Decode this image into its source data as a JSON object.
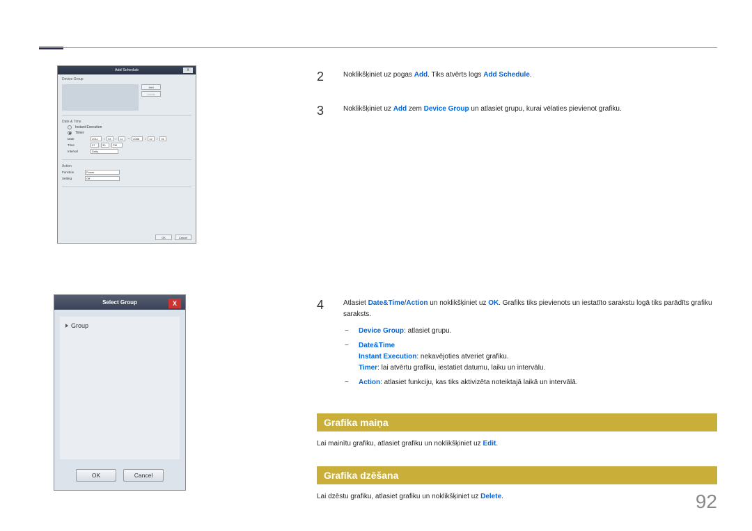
{
  "page_number": "92",
  "steps": {
    "s2": {
      "num": "2",
      "t1": "Noklikšķiniet uz pogas ",
      "b1": "Add",
      "t2": ". Tiks atvērts logs ",
      "b2": "Add Schedule",
      "t3": "."
    },
    "s3": {
      "num": "3",
      "t1": "Noklikšķiniet uz ",
      "b1": "Add",
      "t2": " zem ",
      "b2": "Device Group",
      "t3": " un atlasiet grupu, kurai vēlaties pievienot grafiku."
    },
    "s4": {
      "num": "4",
      "t1a": "Atlasiet ",
      "b1": "Date&Time",
      "slash": "/",
      "b2": "Action",
      "t1b": " un noklikšķiniet uz ",
      "b3": "OK",
      "t1c": ". Grafiks tiks pievienots un iestatīto sarakstu logā tiks parādīts grafiku saraksts.",
      "li1_b": "Device Group",
      "li1_t": ": atlasiet grupu.",
      "li2_b": "Date&Time",
      "li2_ib": "Instant Execution",
      "li2_it": ": nekavējoties atveriet grafiku.",
      "li2_tb": "Timer",
      "li2_tt": ": lai atvērtu grafiku, iestatiet datumu, laiku un intervālu.",
      "li3_b": "Action",
      "li3_t": ":  atlasiet funkciju, kas tiks aktivizēta noteiktajā laikā un intervālā."
    }
  },
  "sections": {
    "change": {
      "heading": "Grafika maiņa",
      "t1": "Lai mainītu grafiku, atlasiet grafiku un noklikšķiniet uz ",
      "b1": "Edit",
      "t2": "."
    },
    "delete": {
      "heading": "Grafika dzēšana",
      "t1": "Lai dzēstu grafiku, atlasiet grafiku un noklikšķiniet uz ",
      "b1": "Delete",
      "t2": "."
    }
  },
  "screenshot1": {
    "title": "Add Schedule",
    "close": "X",
    "device_group": "Device Group",
    "add": "Add",
    "delete": "Delete",
    "date_time": "Date & Time",
    "instant_exec": "Instant Execution",
    "timer": "Timer",
    "date": "Date",
    "date_val1": "2011",
    "date_val2": "04",
    "date_val3": "11",
    "tilde": "~",
    "date_val4": "2088",
    "date_val5": "12",
    "date_val6": "31",
    "time": "Time",
    "time_h": "07",
    "time_m": "30",
    "time_ampm": "PM",
    "interval": "Interval",
    "interval_val": "Daily",
    "action": "Action",
    "function": "Function",
    "function_val": "Power",
    "setting": "Setting",
    "setting_val": "Off",
    "ok": "OK",
    "cancel": "Cancel"
  },
  "screenshot2": {
    "title": "Select Group",
    "close": "X",
    "group": "Group",
    "ok": "OK",
    "cancel": "Cancel"
  }
}
